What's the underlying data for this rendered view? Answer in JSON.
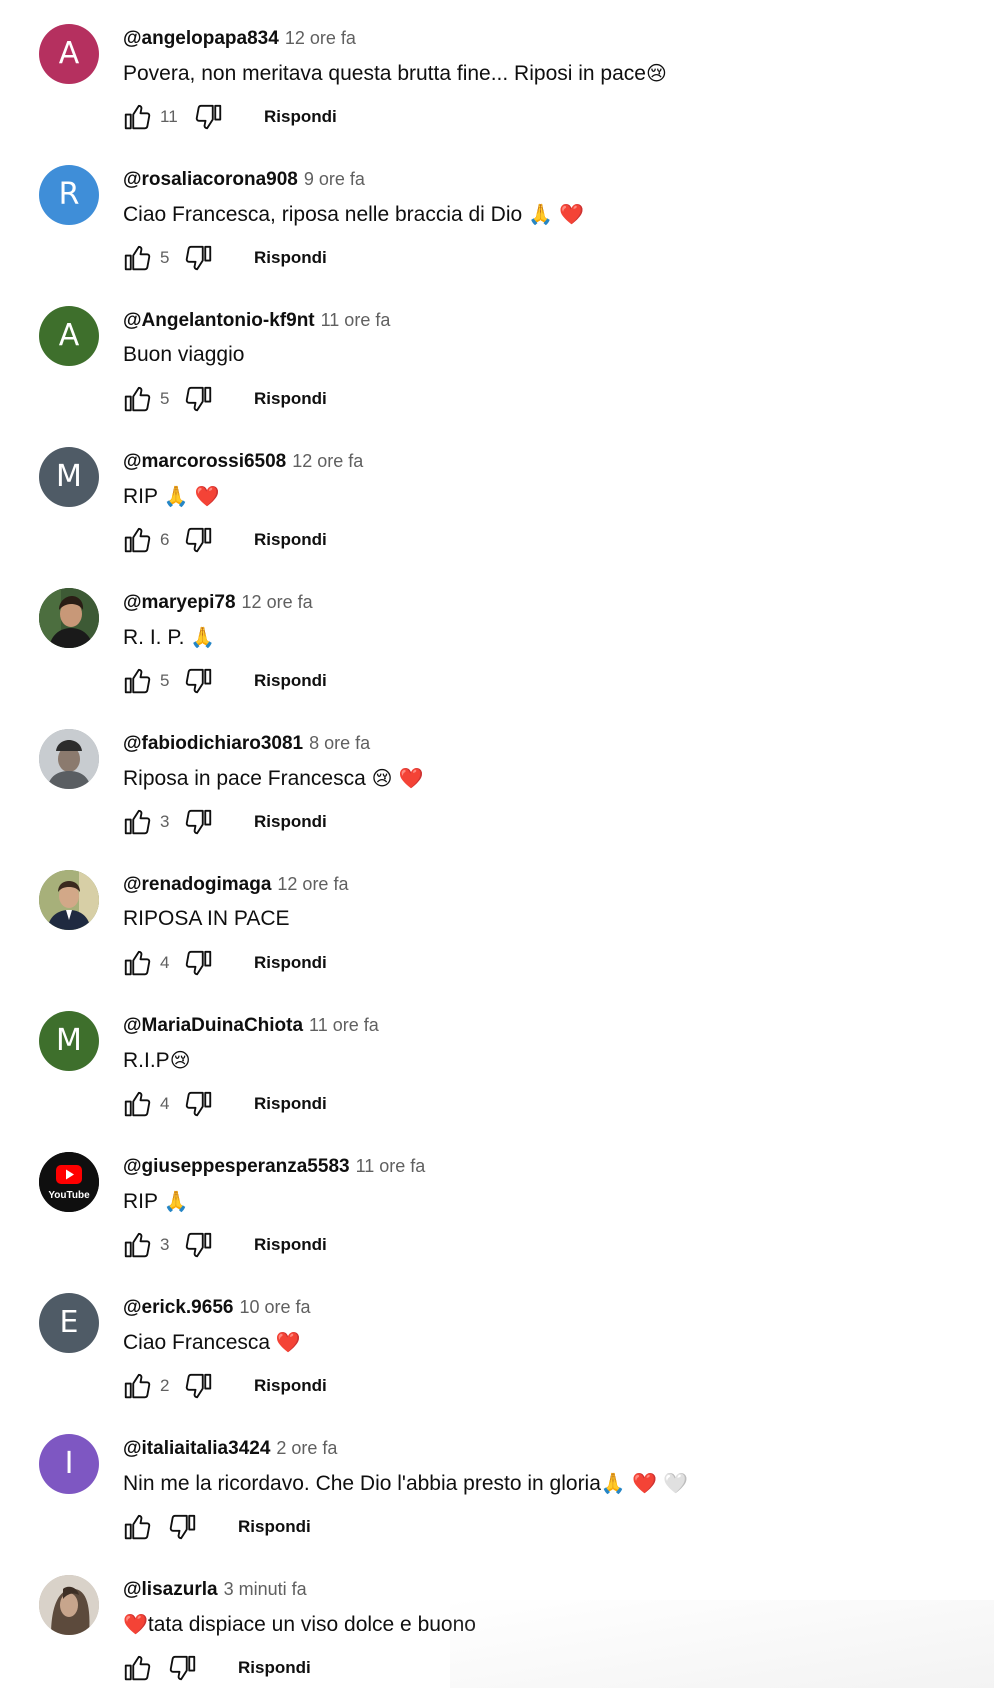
{
  "comments": [
    {
      "avatar_letter": "A",
      "avatar_color": "#b5305f",
      "author": "@angelopapa834",
      "time": "12 ore fa",
      "text": "Povera, non meritava questa brutta fine... Riposi in pace",
      "emoji": "😢",
      "likes": "11",
      "reply": "Rispondi"
    },
    {
      "avatar_letter": "R",
      "avatar_color": "#3f8ed8",
      "author": "@rosaliacorona908",
      "time": "9 ore fa",
      "text": "Ciao Francesca, riposa nelle braccia di Dio",
      "emoji": "🙏 ❤️",
      "likes": "5",
      "reply": "Rispondi"
    },
    {
      "avatar_letter": "A",
      "avatar_color": "#3e6f2c",
      "author": "@Angelantonio-kf9nt",
      "time": "11 ore fa",
      "text": "Buon viaggio",
      "emoji": "",
      "likes": "5",
      "reply": "Rispondi"
    },
    {
      "avatar_letter": "M",
      "avatar_color": "#4f5b66",
      "author": "@marcorossi6508",
      "time": "12 ore fa",
      "text": "RIP",
      "emoji": "🙏 ❤️",
      "likes": "6",
      "reply": "Rispondi"
    },
    {
      "avatar_letter": "",
      "avatar_color": "#2f4a2a",
      "author": "@maryepi78",
      "time": "12 ore fa",
      "text": "R. I. P.",
      "emoji": "🙏",
      "likes": "5",
      "reply": "Rispondi"
    },
    {
      "avatar_letter": "",
      "avatar_color": "#9aa0a6",
      "author": "@fabiodichiaro3081",
      "time": "8 ore fa",
      "text": "Riposa in pace Francesca",
      "emoji": "😢 ❤️",
      "likes": "3",
      "reply": "Rispondi"
    },
    {
      "avatar_letter": "",
      "avatar_color": "#6b7b4e",
      "author": "@renadogimaga",
      "time": "12 ore fa",
      "text": "RIPOSA IN PACE",
      "emoji": "",
      "likes": "4",
      "reply": "Rispondi"
    },
    {
      "avatar_letter": "M",
      "avatar_color": "#3e6f2c",
      "author": "@MariaDuinaChiota",
      "time": "11 ore fa",
      "text": "R.I.P",
      "emoji": "😢",
      "likes": "4",
      "reply": "Rispondi"
    },
    {
      "avatar_letter": "",
      "avatar_color": "#0f0f0f",
      "author": "@giuseppesperanza5583",
      "time": "11 ore fa",
      "text": "RIP",
      "emoji": "🙏",
      "likes": "3",
      "reply": "Rispondi",
      "avatar_logo_text": "YouTube"
    },
    {
      "avatar_letter": "E",
      "avatar_color": "#4f5b66",
      "author": "@erick.9656",
      "time": "10 ore fa",
      "text": "Ciao Francesca",
      "emoji": "❤️",
      "likes": "2",
      "reply": "Rispondi"
    },
    {
      "avatar_letter": "I",
      "avatar_color": "#7e57c2",
      "author": "@italiaitalia3424",
      "time": "2 ore fa",
      "text": "Nin me la ricordavo.  Che Dio l'abbia presto in gloria",
      "emoji": "🙏 ❤️ 🤍",
      "likes": "",
      "reply": "Rispondi"
    },
    {
      "avatar_letter": "",
      "avatar_color": "#b9aea3",
      "author": "@lisazurla",
      "time": "3 minuti fa",
      "text": "tata dispiace un viso dolce e buono",
      "emoji_prefix": "❤️",
      "emoji": "",
      "likes": "",
      "reply": "Rispondi"
    }
  ]
}
